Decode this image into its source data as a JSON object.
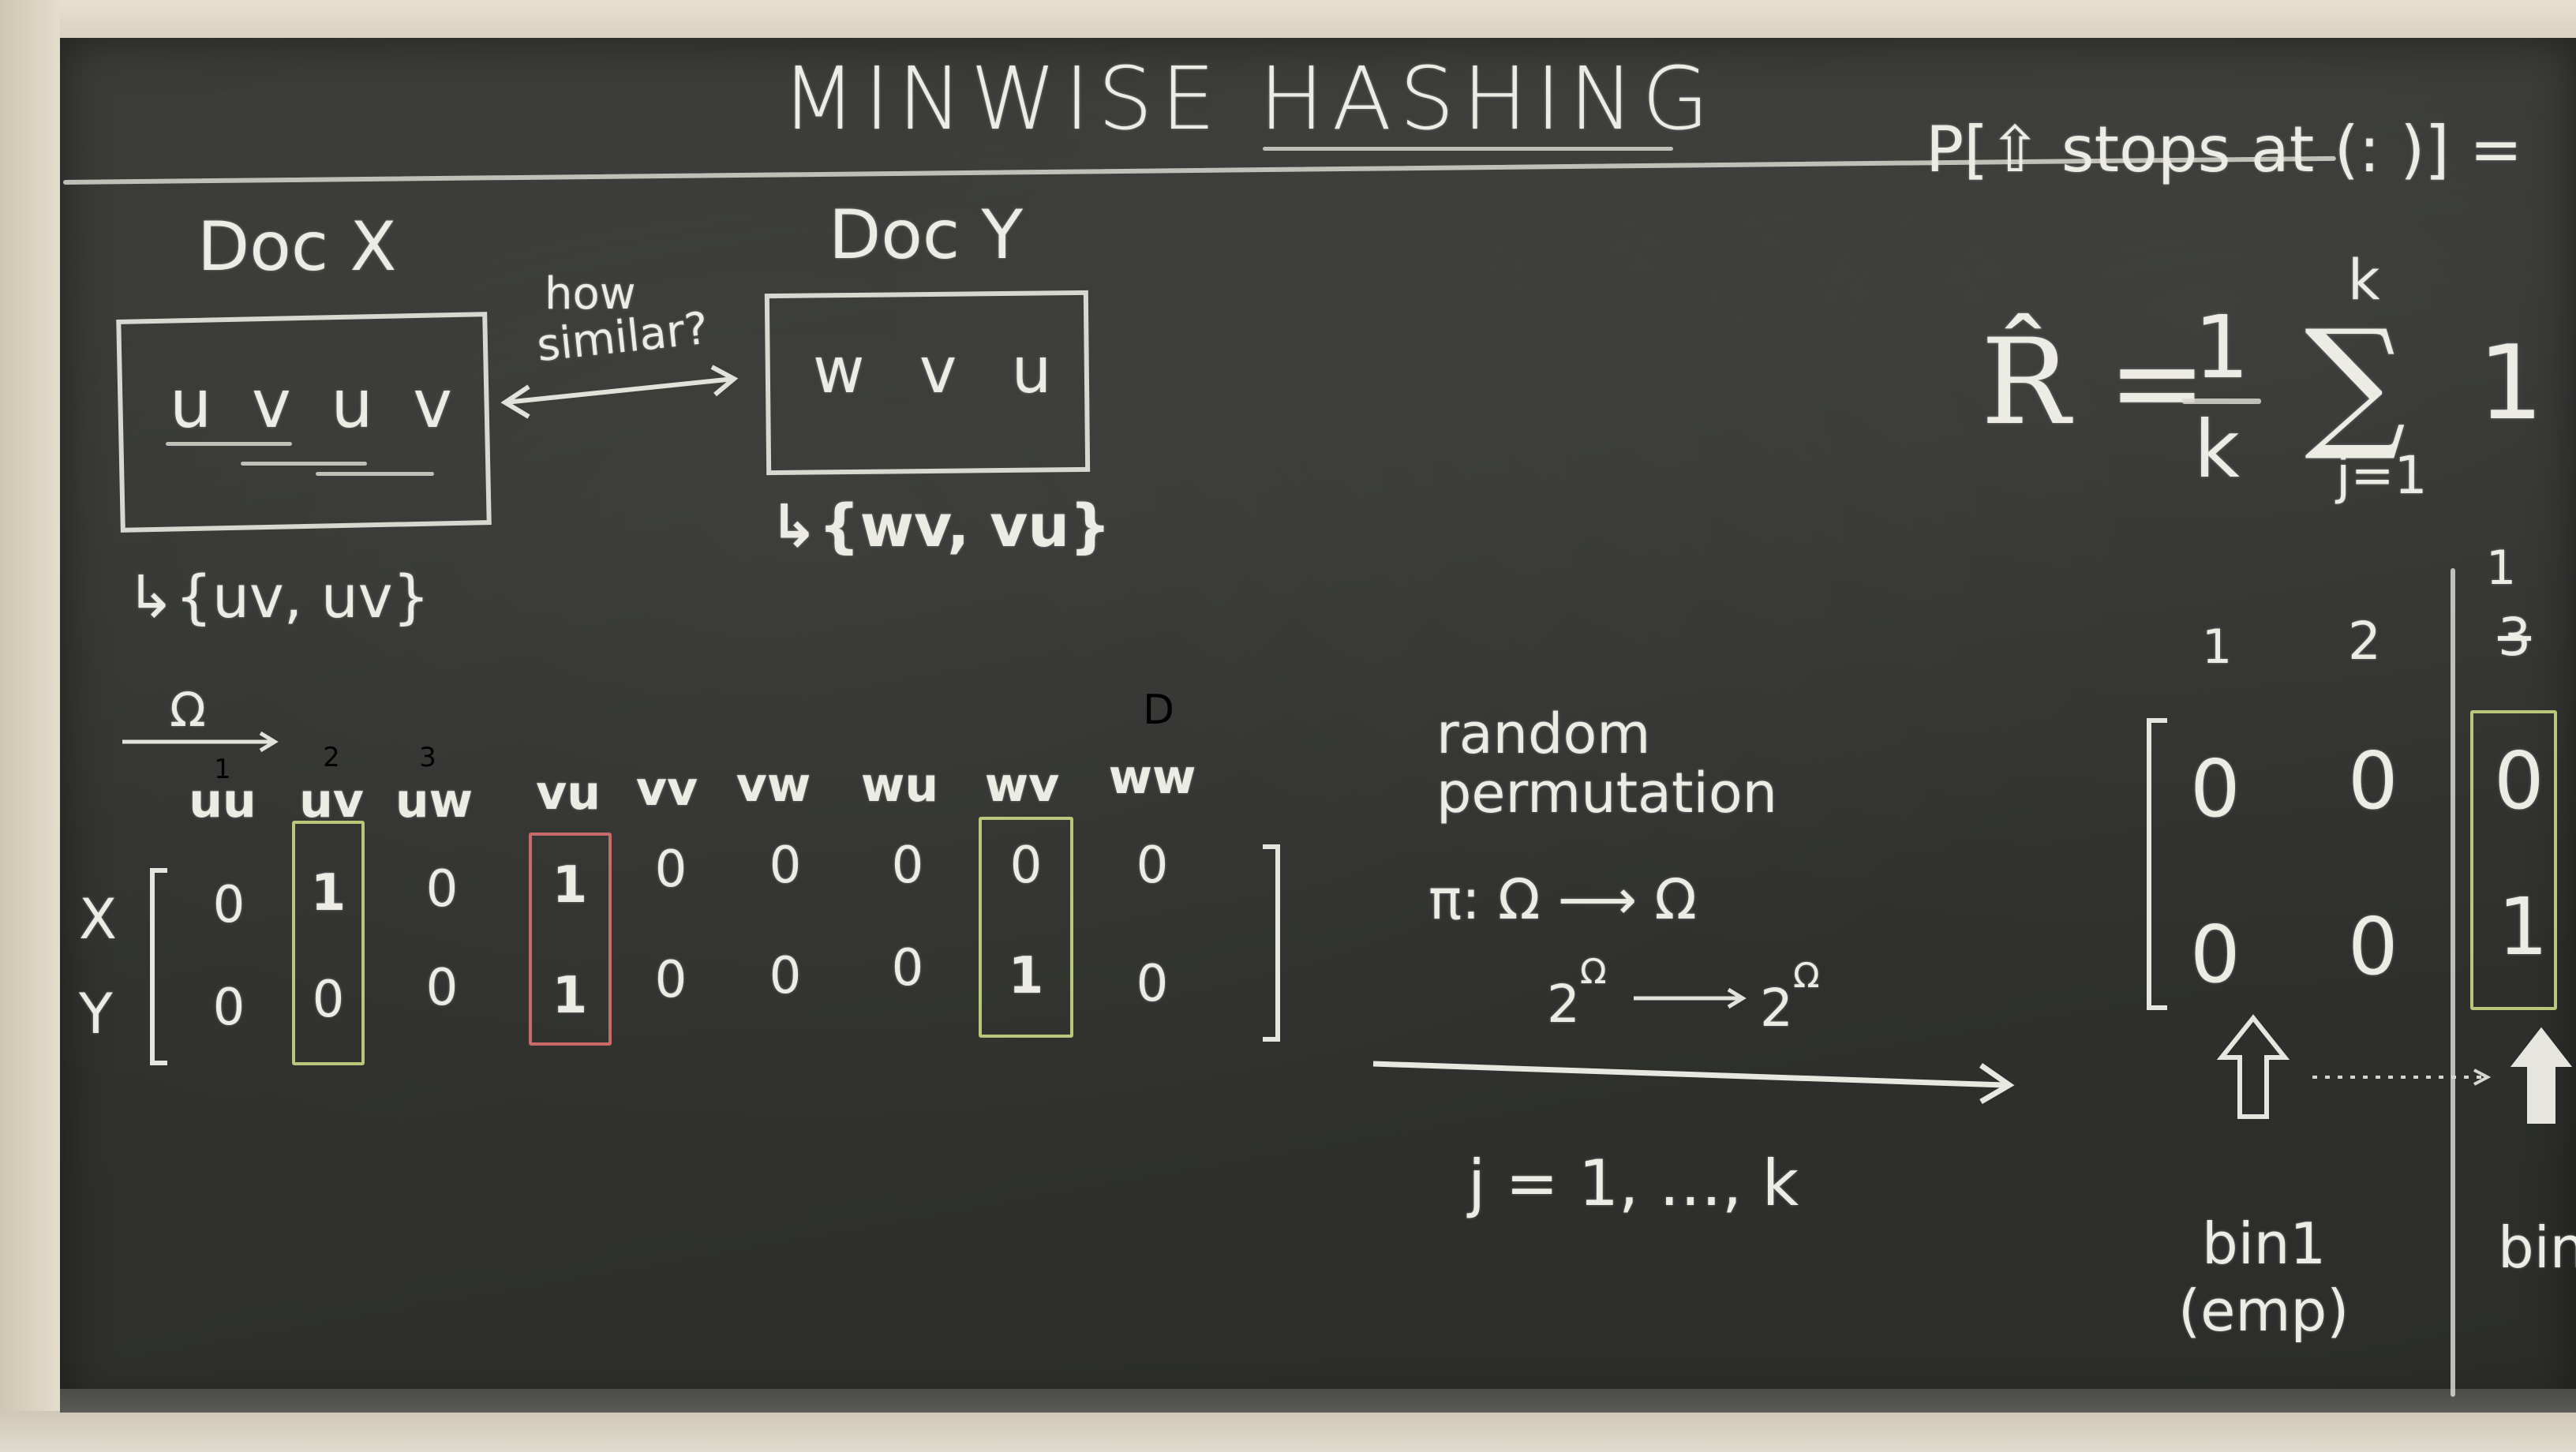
{
  "title": "MINWISE HASHING",
  "doc_x": {
    "label": "Doc X",
    "content": "u v u v",
    "set": "↳{uv, uv}"
  },
  "doc_y": {
    "label": "Doc Y",
    "content": "w v u",
    "set": "↳{wv, vu}"
  },
  "similarity_question": [
    "how",
    "similar?"
  ],
  "omega": "Ω",
  "matrix": {
    "columns": [
      {
        "index": "1",
        "label": "uu"
      },
      {
        "index": "2",
        "label": "uv"
      },
      {
        "index": "3",
        "label": "uw"
      },
      {
        "index": "",
        "label": "vu"
      },
      {
        "index": "",
        "label": "vv"
      },
      {
        "index": "",
        "label": "vw"
      },
      {
        "index": "",
        "label": "wu"
      },
      {
        "index": "",
        "label": "wv"
      },
      {
        "index": "D",
        "label": "ww"
      }
    ],
    "rows": [
      {
        "name": "X",
        "values": [
          "0",
          "1",
          "0",
          "1",
          "0",
          "0",
          "0",
          "0",
          "0"
        ]
      },
      {
        "name": "Y",
        "values": [
          "0",
          "0",
          "0",
          "1",
          "0",
          "0",
          "0",
          "1",
          "0"
        ]
      }
    ],
    "highlight_colors": {
      "uv": "#b9c77a",
      "vu": "#c96a6a",
      "wv": "#b9c77a"
    }
  },
  "permutation": {
    "heading": [
      "random",
      "permutation"
    ],
    "map1": "π: Ω ⟶ Ω",
    "map2_left": "2",
    "map2_right": "2",
    "map2_sup": "Ω",
    "loop": "j = 1, …, k"
  },
  "right": {
    "prob": "P[⇧ stops at (: )] =",
    "estimator_lhs": "R̂ =",
    "frac_num": "1",
    "frac_den": "k",
    "sum_top": "k",
    "sum_sign": "∑",
    "sum_bottom": "j=1",
    "sum_term": "1",
    "bin_matrix": {
      "col_labels": [
        "1",
        "2"
      ],
      "rows": [
        [
          "0",
          "0"
        ],
        [
          "0",
          "0"
        ]
      ]
    },
    "bin_matrix2": {
      "col_label": "1",
      "col_label_struck": "3",
      "rows": [
        "0",
        "1"
      ],
      "highlight_color": "#b9c77a"
    },
    "bin1_label": "bin1",
    "bin1_note": "(emp)",
    "bin2_label": "bin"
  },
  "colors": {
    "board": "#31322f",
    "chalk": "#ecebe4",
    "highlight_green": "#b9c77a",
    "highlight_red": "#c96a6a"
  }
}
